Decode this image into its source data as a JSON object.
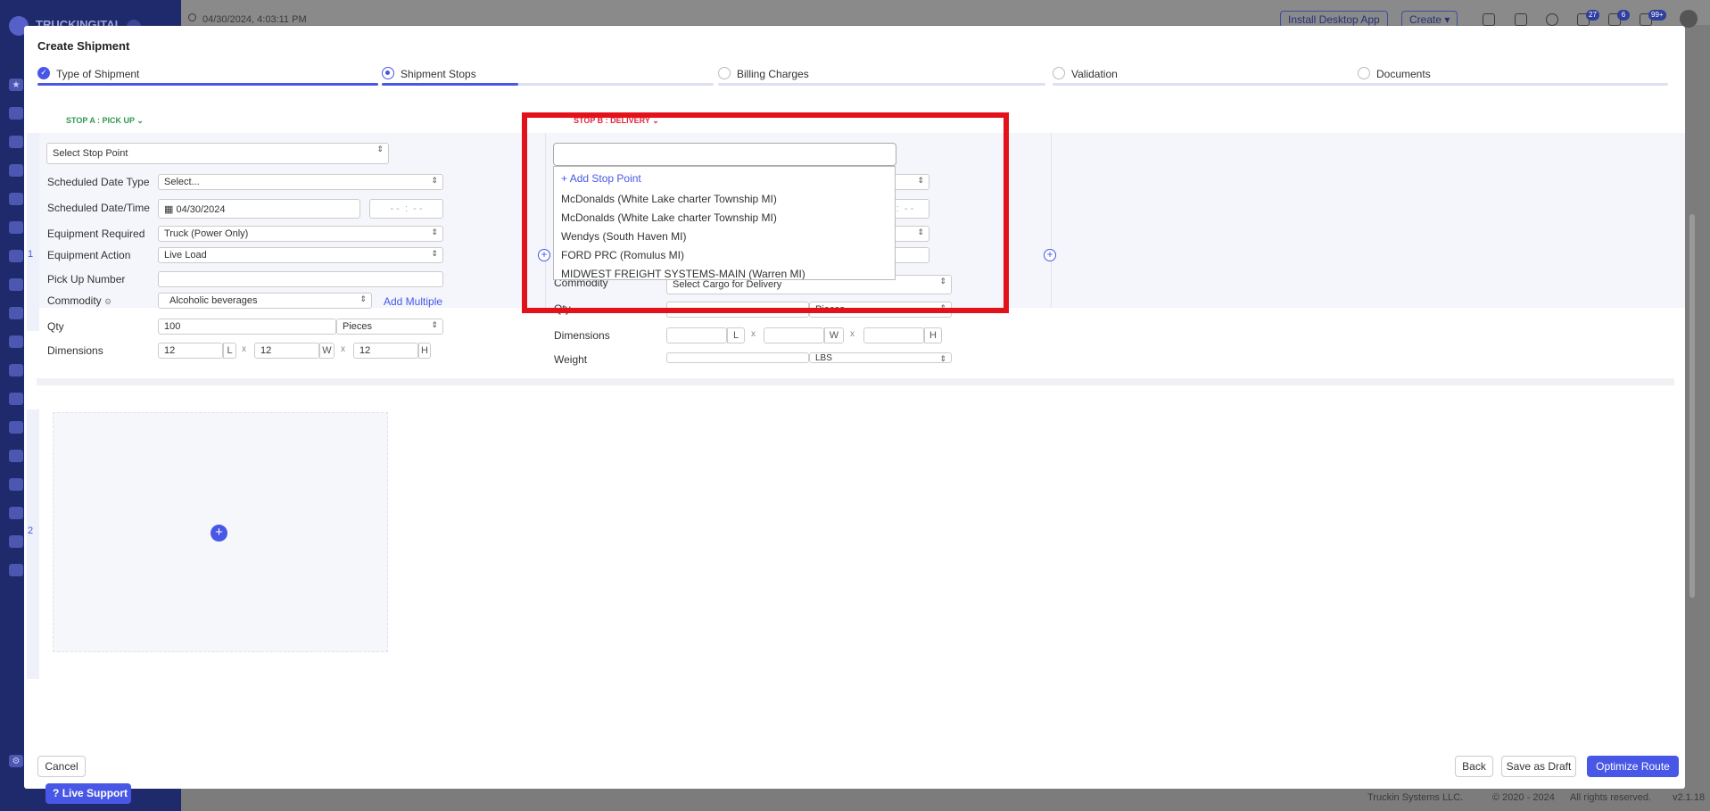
{
  "topbar": {
    "datetime": "04/30/2024, 4:03:11 PM",
    "install_label": "Install Desktop App",
    "create_label": "Create",
    "badges": [
      "27",
      "6",
      "99+"
    ]
  },
  "sidebar": {
    "brand": "TRUCKINGITAL"
  },
  "footer": {
    "company": "Truckin Systems LLC.",
    "copyright": "© 2020 - 2024",
    "rights": "All rights reserved.",
    "version": "v2.1.18"
  },
  "modal": {
    "title": "Create Shipment",
    "steps": [
      {
        "label": "Type of Shipment",
        "state": "done"
      },
      {
        "label": "Shipment Stops",
        "state": "current"
      },
      {
        "label": "Billing Charges",
        "state": "todo"
      },
      {
        "label": "Validation",
        "state": "todo"
      },
      {
        "label": "Documents",
        "state": "todo"
      }
    ]
  },
  "stop_a": {
    "header": "STOP A : PICK UP",
    "index": "1",
    "stop_point": "Select Stop Point",
    "labels": {
      "date_type": "Scheduled Date Type",
      "date_time": "Scheduled Date/Time",
      "equipment": "Equipment Required",
      "action": "Equipment Action",
      "pickup_no": "Pick Up Number",
      "commodity": "Commodity",
      "qty": "Qty",
      "dimensions": "Dimensions"
    },
    "date_type_value": "Select...",
    "date_value": "04/30/2024",
    "time_hours": "- -",
    "time_sep": ":",
    "time_minutes": "- -",
    "equipment_value": "Truck (Power Only)",
    "action_value": "Live Load",
    "pickup_value": "",
    "commodity_value": "Alcoholic beverages",
    "add_multiple": "Add Multiple",
    "qty_value": "100",
    "qty_unit": "Pieces",
    "dim_l": "12",
    "dim_w": "12",
    "dim_h": "12",
    "unit_l": "L",
    "unit_w": "W",
    "unit_h": "H",
    "times": "x"
  },
  "stop_b": {
    "header": "STOP B : DELIVERY",
    "time_sep": ":",
    "time_minutes": "- -",
    "commodity_label": "Commodity",
    "commodity_value": "Select Cargo for Delivery",
    "qty_label": "Qty",
    "qty_unit": "Pieces",
    "dimensions_label": "Dimensions",
    "unit_l": "L",
    "unit_w": "W",
    "unit_h": "H",
    "weight_label": "Weight",
    "weight_unit": "LBS"
  },
  "dropdown": {
    "add_label": "Add Stop Point",
    "items": [
      "McDonalds (White Lake charter Township MI)",
      "McDonalds (White Lake charter Township MI)",
      "Wendys (South Haven MI)",
      "FORD PRC (Romulus MI)",
      "MIDWEST FREIGHT SYSTEMS-MAIN (Warren MI)"
    ]
  },
  "row2": {
    "index": "2"
  },
  "buttons": {
    "cancel": "Cancel",
    "back": "Back",
    "draft": "Save as Draft",
    "optimize": "Optimize Route",
    "live_support": "Live Support"
  },
  "colors": {
    "accent": "#4857e6",
    "highlight": "#e3121a",
    "pickup": "#2e9a4a",
    "delivery": "#e0283a"
  }
}
